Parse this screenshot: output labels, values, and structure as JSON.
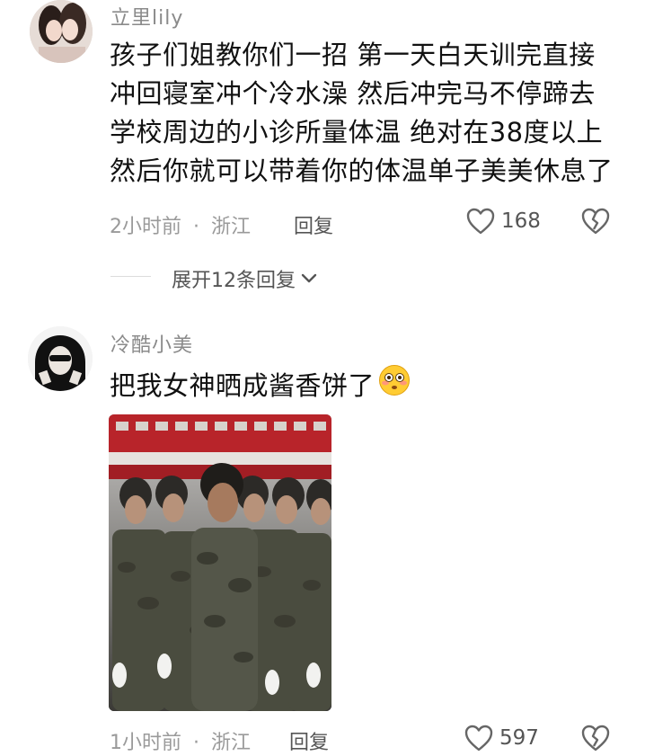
{
  "comments": [
    {
      "username": "立里lily",
      "lines": [
        "孩子们姐教你们一招 第一天白天训完直接",
        "冲回寝室冲个冷水澡 然后冲完马不停蹄去",
        "学校周边的小诊所量体温 绝对在38度以上",
        "然后你就可以带着你的体温单子美美休息了"
      ],
      "time": "2小时前",
      "location": "浙江",
      "reply_label": "回复",
      "likes": "168",
      "expand_label": "展开12条回复"
    },
    {
      "username": "冷酷小美",
      "text": "把我女神晒成酱香饼了",
      "emoji": "😳",
      "time": "1小时前",
      "location": "浙江",
      "reply_label": "回复",
      "likes": "597"
    }
  ],
  "separator": "·",
  "icons": {
    "like": "heart-outline-icon",
    "dislike": "broken-heart-icon",
    "expand": "chevron-down-icon"
  },
  "colors": {
    "meta_gray": "#9a9a9a",
    "username_gray": "#8a8a8a",
    "banner_red": "#b8242a"
  }
}
